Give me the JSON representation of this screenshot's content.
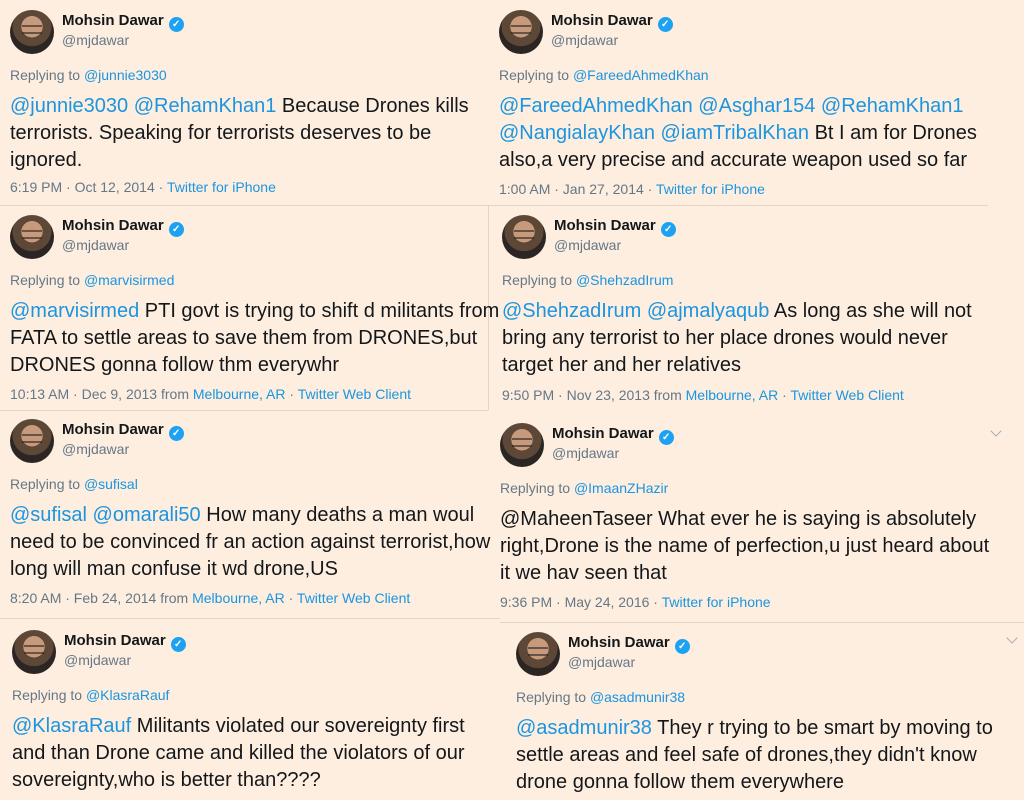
{
  "tweets": [
    {
      "name": "Mohsin Dawar",
      "handle": "@mjdawar",
      "replying_label": "Replying to",
      "replying_to": "@junnie3030",
      "mentions": "@junnie3030 @RehamKhan1",
      "body": " Because Drones kills terrorists. Speaking for terrorists deserves to be ignored.",
      "timestamp": "6:19 PM · Oct 12, 2014 · ",
      "location": "",
      "client": "Twitter for iPhone"
    },
    {
      "name": "Mohsin Dawar",
      "handle": "@mjdawar",
      "replying_label": "Replying to",
      "replying_to": "@FareedAhmedKhan",
      "mentions": "@FareedAhmedKhan @Asghar154 @RehamKhan1 @NangialayKhan @iamTribalKhan",
      "body": " Bt I am for Drones also,a very precise and accurate weapon used so far",
      "timestamp": "1:00 AM · Jan 27, 2014 · ",
      "location": "",
      "client": "Twitter for iPhone"
    },
    {
      "name": "Mohsin Dawar",
      "handle": "@mjdawar",
      "replying_label": "Replying to",
      "replying_to": "@marvisirmed",
      "mentions": "@marvisirmed",
      "body": " PTI govt is trying to shift d militants from FATA to settle areas to save them from DRONES,but DRONES gonna follow thm everywhr",
      "timestamp": "10:13 AM · Dec 9, 2013 from ",
      "location": "Melbourne, AR",
      "client": "Twitter Web Client"
    },
    {
      "name": "Mohsin Dawar",
      "handle": "@mjdawar",
      "replying_label": "Replying to",
      "replying_to": "@ShehzadIrum",
      "mentions": "@ShehzadIrum @ajmalyaqub",
      "body": " As long as she will not bring any terrorist to her place drones would never target her and her relatives",
      "timestamp": "9:50 PM · Nov 23, 2013 from ",
      "location": "Melbourne, AR",
      "client": "Twitter Web Client"
    },
    {
      "name": "Mohsin Dawar",
      "handle": "@mjdawar",
      "replying_label": "Replying to",
      "replying_to": "@sufisal",
      "mentions": "@sufisal @omarali50",
      "body": " How many deaths a man woul need to be convinced fr an action against terrorist,how long will man confuse it wd drone,US",
      "timestamp": "8:20 AM · Feb 24, 2014 from ",
      "location": "Melbourne, AR",
      "client": "Twitter Web Client"
    },
    {
      "name": "Mohsin Dawar",
      "handle": "@mjdawar",
      "replying_label": "Replying to",
      "replying_to": "@ImaanZHazir",
      "mentions": "",
      "body": "@MaheenTaseer What ever he is saying is absolutely right,Drone is the name of perfection,u just heard about it we hav seen that",
      "timestamp": "9:36 PM · May 24, 2016 · ",
      "location": "",
      "client": "Twitter for iPhone"
    },
    {
      "name": "Mohsin Dawar",
      "handle": "@mjdawar",
      "replying_label": "Replying to",
      "replying_to": "@KlasraRauf",
      "mentions": "@KlasraRauf",
      "body": " Militants violated our sovereignty first and than Drone came and killed the violators of our sovereignty,who is better than????",
      "timestamp": "",
      "location": "",
      "client": ""
    },
    {
      "name": "Mohsin Dawar",
      "handle": "@mjdawar",
      "replying_label": "Replying to",
      "replying_to": "@asadmunir38",
      "mentions": "@asadmunir38",
      "body": " They r trying to be smart by moving to settle areas and feel safe of drones,they didn't know drone gonna follow them everywhere",
      "timestamp": "",
      "location": "",
      "client": ""
    }
  ],
  "colors": {
    "background": "#fdeee0",
    "link": "#1b95e0",
    "muted": "#657786",
    "verified": "#1da1f2"
  },
  "icons": [
    "verified-badge-icon",
    "chevron-down-icon"
  ]
}
